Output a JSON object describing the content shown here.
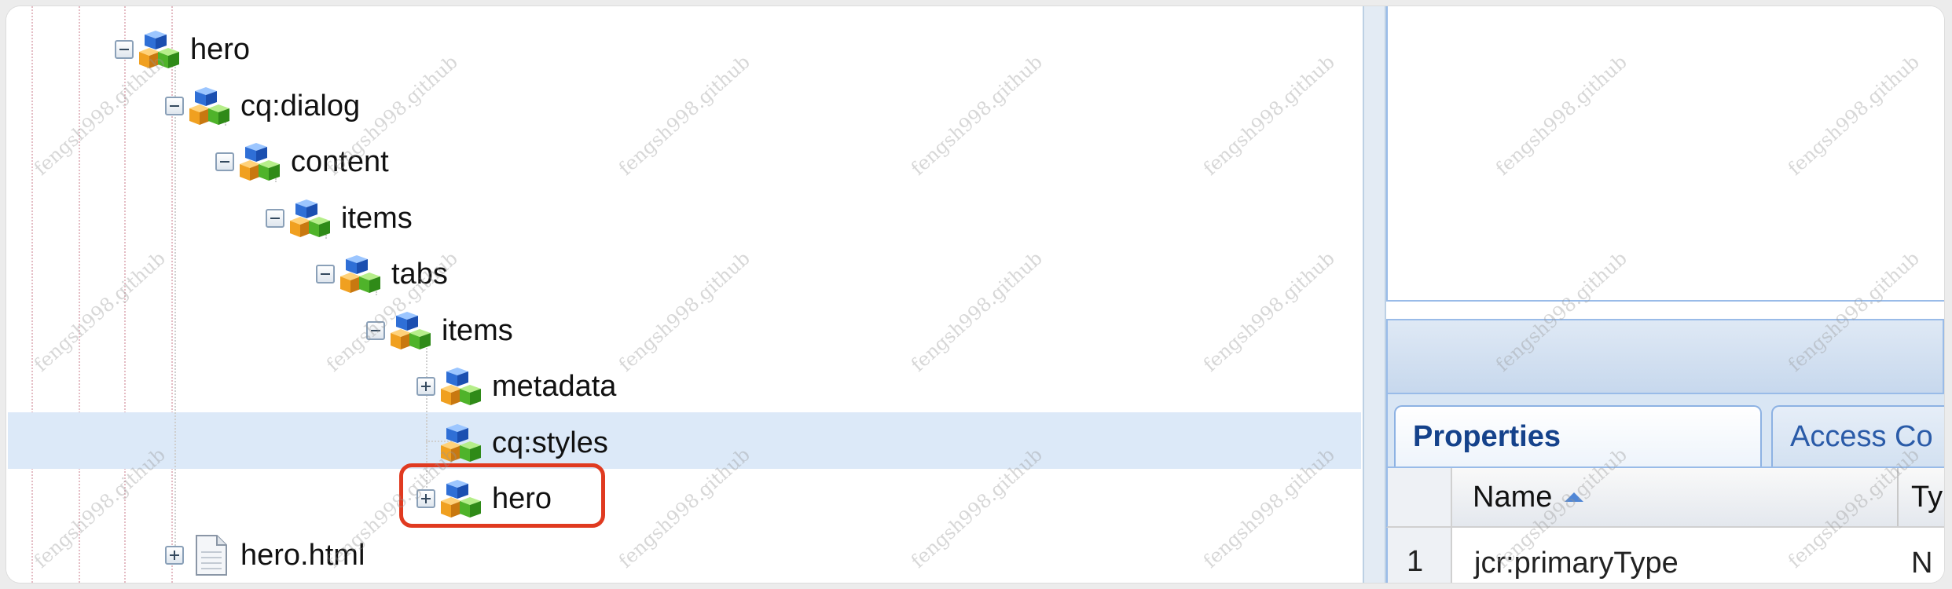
{
  "tree": {
    "nodes": [
      {
        "label": "hero",
        "icon": "node-cube-icon",
        "toggle": "minus"
      },
      {
        "label": "cq:dialog",
        "icon": "node-cube-icon",
        "toggle": "minus"
      },
      {
        "label": "content",
        "icon": "node-cube-icon",
        "toggle": "minus"
      },
      {
        "label": "items",
        "icon": "node-cube-icon",
        "toggle": "minus"
      },
      {
        "label": "tabs",
        "icon": "node-cube-icon",
        "toggle": "minus"
      },
      {
        "label": "items",
        "icon": "node-cube-icon",
        "toggle": "minus"
      },
      {
        "label": "metadata",
        "icon": "node-cube-icon",
        "toggle": "plus"
      },
      {
        "label": "cq:styles",
        "icon": "node-cube-icon",
        "toggle": "none",
        "highlighted": true
      },
      {
        "label": "hero",
        "icon": "node-cube-icon",
        "toggle": "plus",
        "annotated": true
      },
      {
        "label": "hero.html",
        "icon": "file-icon",
        "toggle": "plus"
      }
    ]
  },
  "properties": {
    "tabs": [
      "Properties",
      "Access Co"
    ],
    "columns": {
      "name": "Name",
      "type": "Ty"
    },
    "rows": [
      {
        "num": "1",
        "name": "jcr:primaryType",
        "type": "N"
      }
    ]
  },
  "colors": {
    "highlight_row": "#dce9f8",
    "annotation_border": "#e03a20",
    "panel_border": "#99bbe8",
    "tab_text": "#15428b"
  },
  "watermark": "fengsh998.github"
}
